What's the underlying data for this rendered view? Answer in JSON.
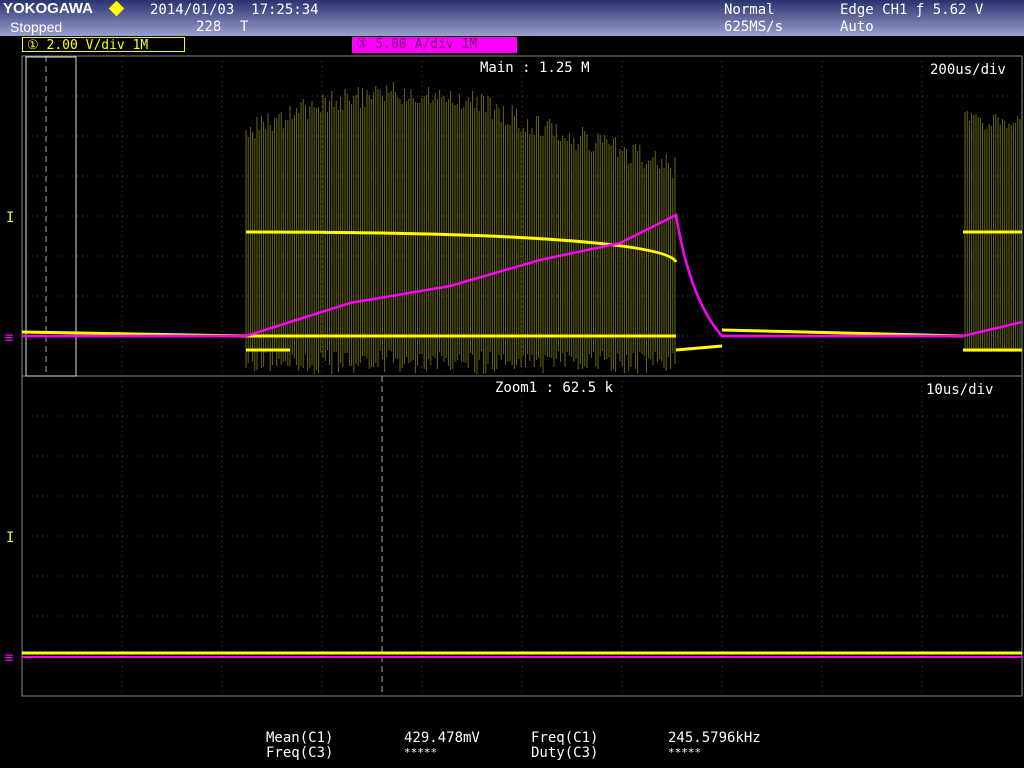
{
  "header": {
    "brand": "YOKOGAWA",
    "datetime": "2014/01/03  17:25:34",
    "status": "Stopped",
    "record_count": "228",
    "trigger_pos_marker": "T",
    "acq_mode": "Normal",
    "sample_rate": "625MS/s",
    "trigger": "Edge CH1 ƒ 5.62 V",
    "trigger_mode": "Auto"
  },
  "channels": [
    {
      "label": "① 2.00 V/div 1M",
      "color": "#ffff00"
    },
    {
      "label": "③ 5.00 A/div 1M",
      "color": "#ff00ff"
    }
  ],
  "main": {
    "title": "Main : 1.25 M",
    "timebase": "200us/div"
  },
  "zoom": {
    "title": "Zoom1 : 62.5 k",
    "timebase": "10us/div"
  },
  "measurements": [
    {
      "name": "Mean(C1)",
      "value": "429.478mV"
    },
    {
      "name": "Freq(C1)",
      "value": "245.5796kHz"
    },
    {
      "name": "Freq(C3)",
      "value": "*****"
    },
    {
      "name": "Duty(C3)",
      "value": "*****"
    }
  ]
}
